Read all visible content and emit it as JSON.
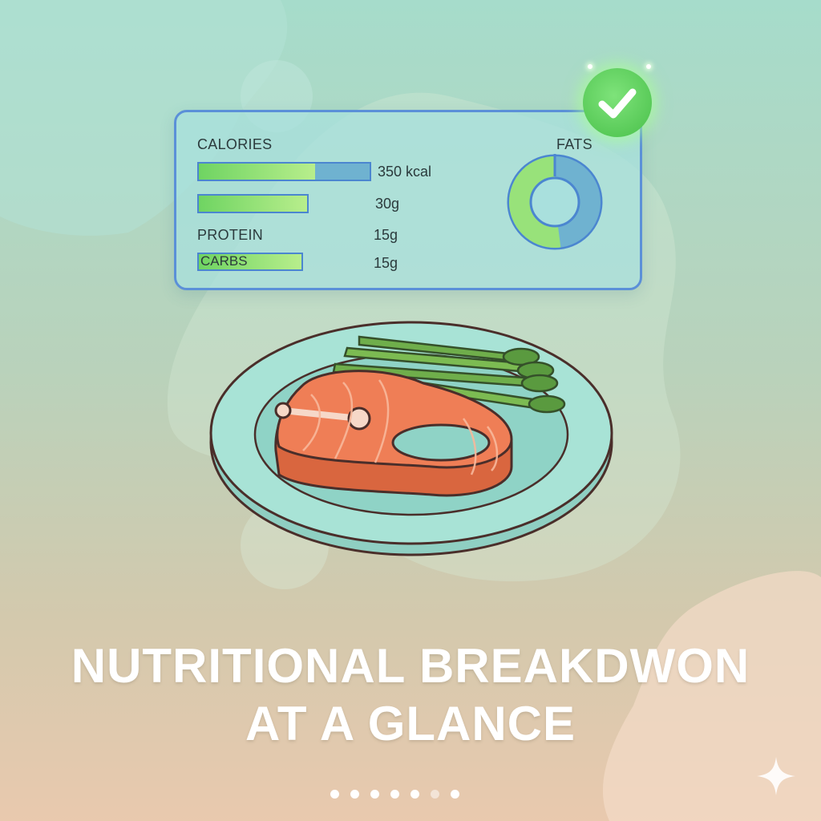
{
  "nutrition_card": {
    "calories_label": "CALORIES",
    "calories_value": "350 kcal",
    "calories_progress": 0.68,
    "row2_value": "30g",
    "row2_progress": 1.0,
    "protein_label": "PROTEIN",
    "protein_value": "15g",
    "carbs_label": "CARBS",
    "carbs_value": "15g",
    "carbs_progress": 1.0,
    "fats_label": "FATS",
    "fats_donut_green_fraction": 0.52
  },
  "headline": {
    "line1": "NUTRITIONAL BREAKDWON",
    "line2": "AT A GLANCE"
  },
  "pagination": {
    "count": 7,
    "active_index": 4,
    "inactive_index": 5
  },
  "icons": {
    "check": "check-circle-icon",
    "sparkle": "sparkle-icon"
  },
  "colors": {
    "accent_green": "#6fd462",
    "accent_blue": "#5b90d8",
    "bar_blue": "#6fb2d0",
    "salmon": "#ef7e56",
    "asparagus": "#6fae4b"
  }
}
